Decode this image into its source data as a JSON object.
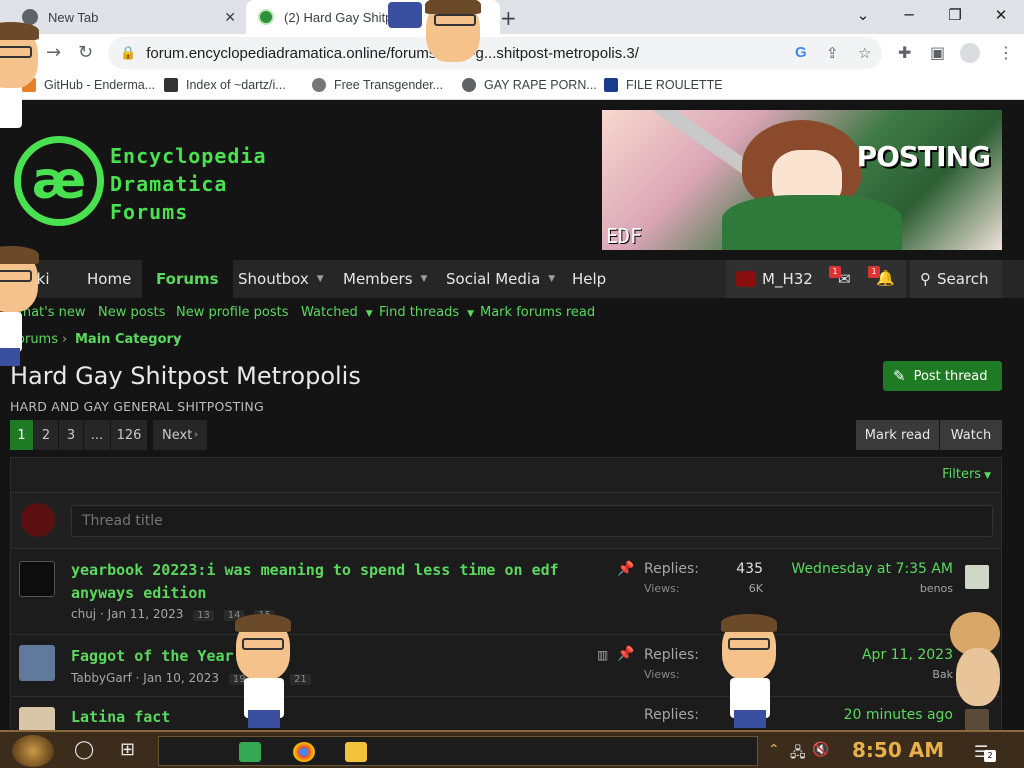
{
  "browser": {
    "tabs": [
      {
        "title": "New Tab"
      },
      {
        "title": "(2) Hard Gay Shitp"
      }
    ],
    "url": "forum.encyclopediadramatica.online/forums/hard-g...shitpost-metropolis.3/",
    "bookmarks": [
      {
        "label": "GitHub - Enderma..."
      },
      {
        "label": "Index of ~dartz/i..."
      },
      {
        "label": "Free Transgender..."
      },
      {
        "label": "GAY RAPE PORN..."
      },
      {
        "label": "FILE ROULETTE"
      }
    ]
  },
  "site": {
    "logo_lines": [
      "Encyclopedia",
      "Dramatica",
      "Forums"
    ],
    "logo_glyph": "æ",
    "banner_text": "POSTING",
    "banner_corner": "EDF",
    "nav": [
      {
        "label": "Wiki"
      },
      {
        "label": "Home"
      },
      {
        "label": "Forums"
      },
      {
        "label": "Shoutbox"
      },
      {
        "label": "Members"
      },
      {
        "label": "Social Media"
      },
      {
        "label": "Help"
      }
    ],
    "user": {
      "name": "M_H32",
      "inbox_count": "1",
      "alerts_count": "1"
    },
    "search_label": "Search",
    "subnav": [
      {
        "label": "What's new"
      },
      {
        "label": "New posts"
      },
      {
        "label": "New profile posts"
      },
      {
        "label": "Watched"
      },
      {
        "label": "Find threads"
      },
      {
        "label": "Mark forums read"
      }
    ],
    "breadcrumb": [
      "Forums",
      "Main Category"
    ],
    "page_title": "Hard Gay Shitpost Metropolis",
    "page_description": "HARD AND GAY GENERAL SHITPOSTING",
    "post_thread_label": "Post thread",
    "pagination": {
      "pages": [
        "1",
        "2",
        "3",
        "...",
        "126"
      ],
      "next": "Next"
    },
    "mark_read_label": "Mark read",
    "watch_label": "Watch",
    "filters_label": "Filters",
    "thread_title_placeholder": "Thread title",
    "threads": [
      {
        "title_line1": "yearbook 20223:i was meaning to spend less time on edf",
        "title_line2": "anyways edition",
        "author": "chuj",
        "date": "Jan 11, 2023",
        "pages": [
          "13",
          "14",
          "15"
        ],
        "replies_label": "Replies:",
        "replies": "435",
        "views_label": "Views:",
        "views": "6K",
        "last_date": "Wednesday at 7:35 AM",
        "last_user": "benos"
      },
      {
        "title_line1": "Faggot of the Year",
        "title_line2": "",
        "author": "TabbyGarf",
        "date": "Jan 10, 2023",
        "pages": [
          "19",
          "20",
          "21"
        ],
        "replies_label": "Replies:",
        "replies": "",
        "views_label": "Views:",
        "views": "",
        "last_date": "Apr 11, 2023",
        "last_user": "Bak"
      },
      {
        "title_line1": "Latina fact",
        "title_line2": "",
        "author": "",
        "date": "",
        "pages": [],
        "replies_label": "Replies:",
        "replies": "0",
        "views_label": "",
        "views": "",
        "last_date": "20 minutes ago",
        "last_user": ""
      }
    ]
  },
  "taskbar": {
    "clock": "8:50 AM",
    "notification_count": "2"
  },
  "colors": {
    "accent_green": "#5bd85e",
    "logo_green": "#49e14f",
    "button_green": "#1f7a24",
    "background": "#141414"
  }
}
